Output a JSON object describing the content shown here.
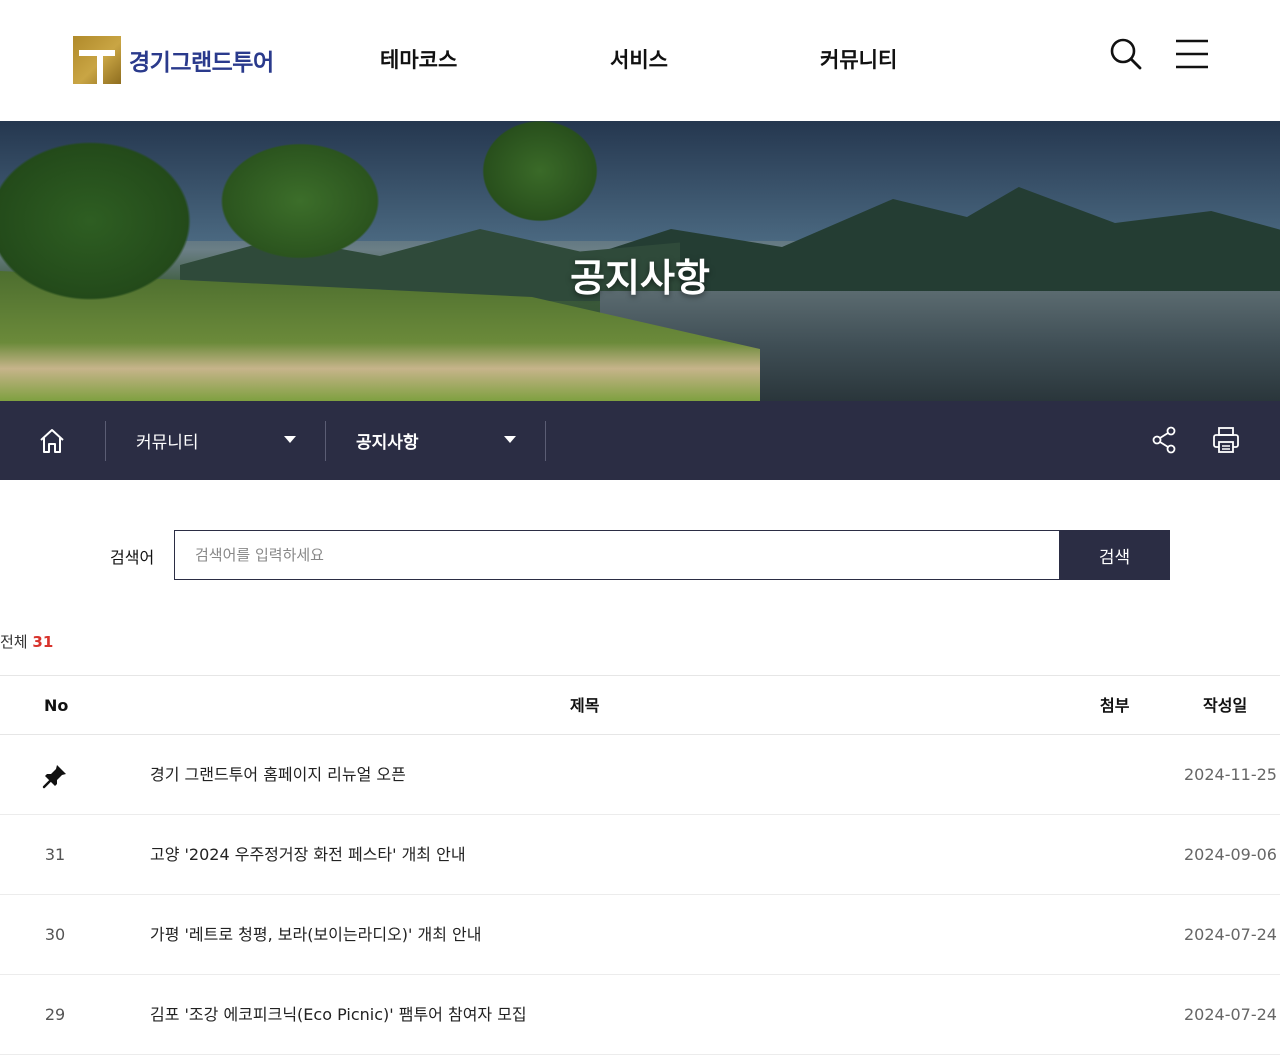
{
  "header": {
    "logo_text": "경기그랜드투어",
    "nav": [
      "테마코스",
      "서비스",
      "커뮤니티"
    ],
    "icons": [
      "search-icon",
      "hamburger-menu-icon"
    ]
  },
  "hero": {
    "title": "공지사항"
  },
  "location": {
    "depth1": "커뮤니티",
    "depth2": "공지사항",
    "icons": [
      "home-icon",
      "share-icon",
      "print-icon"
    ]
  },
  "search": {
    "label": "검색어",
    "placeholder": "검색어를 입력하세요",
    "button_label": "검색"
  },
  "summary": {
    "total_label": "전체",
    "total_count": "31"
  },
  "table": {
    "headers": {
      "no": "No",
      "title": "제목",
      "attachment": "첨부",
      "date": "작성일"
    },
    "rows": [
      {
        "no": "",
        "pinned": true,
        "title": "경기 그랜드투어 홈페이지 리뉴얼 오픈",
        "date": "2024-11-25"
      },
      {
        "no": "31",
        "pinned": false,
        "title": "고양 '2024 우주정거장 화전 페스타' 개최 안내",
        "date": "2024-09-06"
      },
      {
        "no": "30",
        "pinned": false,
        "title": "가평 '레트로 청평, 보라(보이는라디오)' 개최 안내",
        "date": "2024-07-24"
      },
      {
        "no": "29",
        "pinned": false,
        "title": "김포 '조강 에코피크닉(Eco Picnic)' 팸투어 참여자 모집",
        "date": "2024-07-24"
      }
    ]
  },
  "colors": {
    "brand_navy": "#2b2d44",
    "accent_red": "#d8332c",
    "logo_blue": "#2a3a8c",
    "logo_gold": "#c9a544"
  }
}
